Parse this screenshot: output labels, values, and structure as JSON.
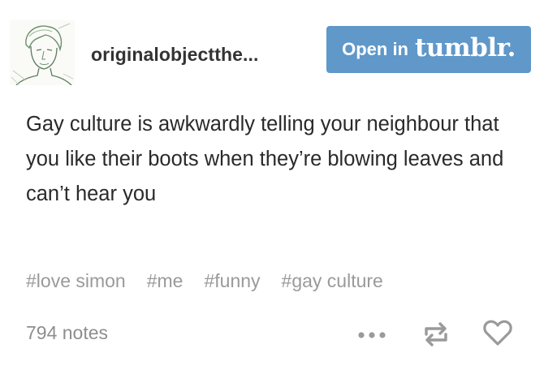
{
  "blog": {
    "username": "originalobjectthe...",
    "avatar_icon": "sketch-portrait-avatar"
  },
  "header": {
    "open_label": "Open in",
    "brand": "tumblr.",
    "button_color": "#5f98c9"
  },
  "post": {
    "text": "Gay culture is awkwardly telling your neighbour that you like their boots when they’re blowing leaves and can’t hear you"
  },
  "tags": [
    "#love simon",
    "#me",
    "#funny",
    "#gay culture"
  ],
  "footer": {
    "notes": "794 notes",
    "icons": [
      "more-icon",
      "reblog-icon",
      "heart-icon"
    ]
  }
}
